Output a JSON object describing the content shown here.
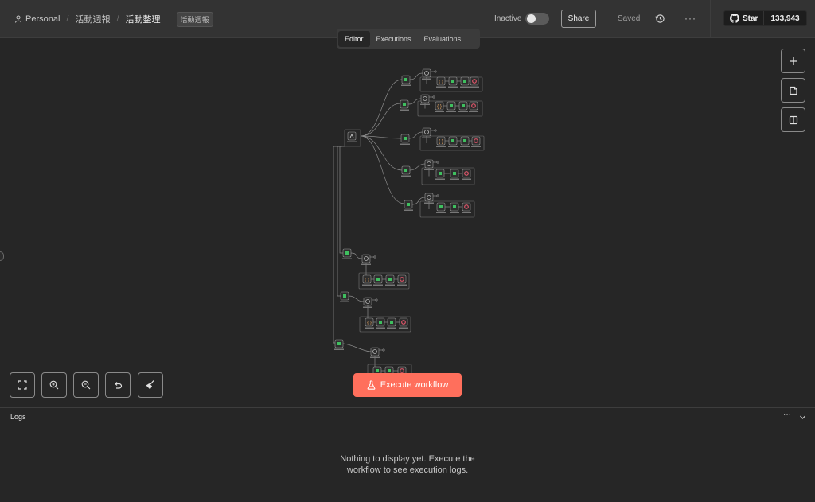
{
  "breadcrumb": {
    "owner": "Personal",
    "folder": "活動週報",
    "workflow": "活動整理",
    "tag": "活動週報"
  },
  "header": {
    "status_label": "Inactive",
    "share_label": "Share",
    "saved_label": "Saved",
    "more_label": "···",
    "github_star_label": "Star",
    "github_star_count": "133,943"
  },
  "tabs": [
    {
      "label": "Editor",
      "active": true
    },
    {
      "label": "Executions",
      "active": false
    },
    {
      "label": "Evaluations",
      "active": false
    }
  ],
  "canvas": {
    "right_tools": [
      "plus-icon",
      "sticky-note-icon",
      "panel-icon"
    ],
    "bottom_tools": [
      "fit-view-icon",
      "zoom-in-icon",
      "zoom-out-icon",
      "undo-icon",
      "tidy-up-icon"
    ],
    "execute_label": "Execute workflow"
  },
  "logs": {
    "title": "Logs",
    "more_label": "···",
    "empty_message": "Nothing to display yet. Execute the workflow to see execution logs."
  },
  "colors": {
    "accent": "#ff6f5c",
    "background": "#262626",
    "header": "#333333",
    "node_green": "#3fbf5f",
    "node_red": "#e0566b"
  }
}
